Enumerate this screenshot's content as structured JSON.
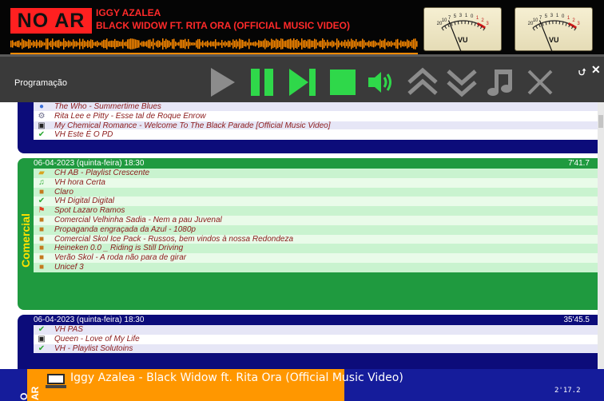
{
  "header": {
    "onair_label": "NO AR",
    "artist": "IGGY AZALEA",
    "title": "BLACK WIDOW FT. RITA ORA (OFFICIAL MUSIC VIDEO)",
    "vu_label": "VU",
    "vu_scale": [
      "20",
      "10",
      "7",
      "5",
      "3",
      "1",
      "0",
      "1",
      "2",
      "3"
    ]
  },
  "toolbar": {
    "section_label": "Programação",
    "buttons": [
      "play-icon",
      "pause-icon",
      "skip-next-icon",
      "stop-icon",
      "volume-icon",
      "move-up-icon",
      "move-down-icon",
      "music-note-icon",
      "close-icon"
    ],
    "pin_glyph": "⮍"
  },
  "blocks": [
    {
      "color": "#0c0c7a",
      "items": [
        {
          "icon": "cd-icon",
          "text": "The Who - Summertime Blues"
        },
        {
          "icon": "settings-icon",
          "text": "Rita Lee e Pitty - Esse tal de Roque Enrow"
        },
        {
          "icon": "computer-icon",
          "text": "My Chemical Romance - Welcome To The Black Parade [Official Music Video]"
        },
        {
          "icon": "check-icon",
          "text": "VH Este É O PD"
        }
      ]
    },
    {
      "color": "#1f9a3f",
      "date": "06-04-2023 (quinta-feira) 18:30",
      "duration": "7'41.7",
      "side_label": "Comercial",
      "items": [
        {
          "icon": "folder-icon",
          "text": "CH AB - Playlist Crescente"
        },
        {
          "icon": "music-note-icon",
          "text": "VH hora Certa"
        },
        {
          "icon": "package-icon",
          "text": "Claro"
        },
        {
          "icon": "check-icon",
          "text": "VH Digital Digital"
        },
        {
          "icon": "flag-icon",
          "text": "Spot Lazaro Ramos"
        },
        {
          "icon": "package-icon",
          "text": "Comercial Velhinha Sadia - Nem a pau Juvenal"
        },
        {
          "icon": "package-icon",
          "text": "Propaganda engraçada da Azul - 1080p"
        },
        {
          "icon": "package-icon",
          "text": "Comercial Skol Ice Pack - Russos, bem vindos à nossa Redondeza"
        },
        {
          "icon": "package-icon",
          "text": "Heineken 0.0 _ Riding is Still Driving"
        },
        {
          "icon": "package-icon",
          "text": "Verão Skol - A roda não para de girar"
        },
        {
          "icon": "package-icon",
          "text": "Unicef 3"
        }
      ]
    },
    {
      "color": "#0c0c7a",
      "date": "06-04-2023 (quinta-feira) 18:30",
      "duration": "35'45.5",
      "items": [
        {
          "icon": "check-icon",
          "text": "VH PAS"
        },
        {
          "icon": "computer-icon",
          "text": "Queen - Love of My Life"
        },
        {
          "icon": "check-icon",
          "text": "VH - Playlist Solutoins"
        }
      ]
    }
  ],
  "now_playing": {
    "side_label": "O AR",
    "text": "Iggy Azalea - Black Widow ft. Rita Ora (Official Music Video)",
    "time": "2'17.2",
    "progress": 0.55
  },
  "colors": {
    "onair": "#ff2020",
    "toolbar_icon": "#2fd84a",
    "toolbar_icon_inactive": "#8c8c8c",
    "blue_block": "#0c0c7a",
    "green_block": "#1f9a3f",
    "orange_progress": "#ff9700",
    "item_text": "#8b1a1a"
  }
}
